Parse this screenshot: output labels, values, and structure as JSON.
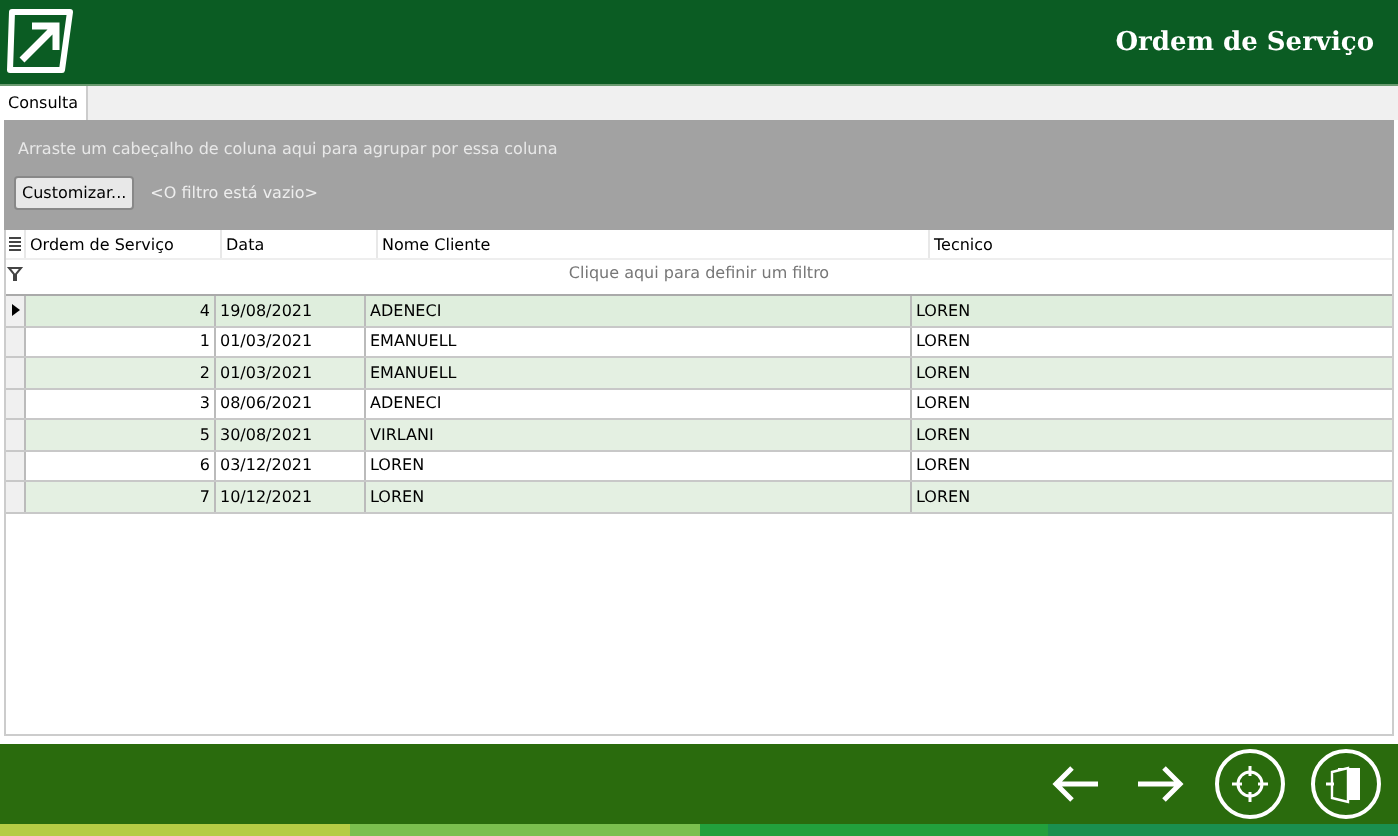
{
  "window": {
    "title": "Ordem de Serviço"
  },
  "tabs": [
    {
      "label": "Consulta",
      "selected": true
    }
  ],
  "group_panel": {
    "hint": "Arraste um cabeçalho de coluna aqui para agrupar por essa coluna"
  },
  "filter_bar": {
    "button": "Customizar...",
    "status": "<O filtro está vazio>"
  },
  "table": {
    "columns": [
      "Ordem de Serviço",
      "Data",
      "Nome Cliente",
      "Tecnico"
    ],
    "filter_row": "Clique aqui para definir um filtro",
    "rows": [
      {
        "cells": [
          "4",
          "19/08/2021",
          "ADENECI",
          "LOREN"
        ],
        "selected": true
      },
      {
        "cells": [
          "1",
          "01/03/2021",
          "EMANUELL",
          "LOREN"
        ],
        "selected": false
      },
      {
        "cells": [
          "2",
          "01/03/2021",
          "EMANUELL",
          "LOREN"
        ],
        "selected": false
      },
      {
        "cells": [
          "3",
          "08/06/2021",
          "ADENECI",
          "LOREN"
        ],
        "selected": false
      },
      {
        "cells": [
          "5",
          "30/08/2021",
          "VIRLANI",
          "LOREN"
        ],
        "selected": false
      },
      {
        "cells": [
          "6",
          "03/12/2021",
          "LOREN",
          "LOREN"
        ],
        "selected": false
      },
      {
        "cells": [
          "7",
          "10/12/2021",
          "LOREN",
          "LOREN"
        ],
        "selected": false
      }
    ]
  }
}
